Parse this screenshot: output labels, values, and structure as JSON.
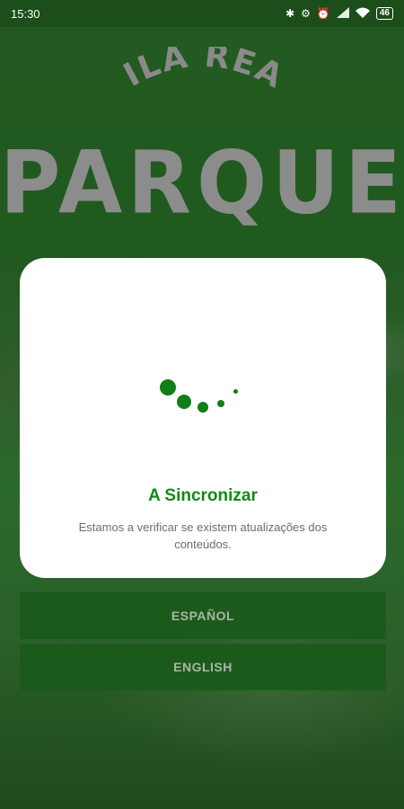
{
  "status_bar": {
    "time": "15:30",
    "battery": "46",
    "icons": [
      "bluetooth-icon",
      "data-saver-icon",
      "alarm-icon",
      "signal-icon",
      "wifi-icon",
      "battery-icon"
    ]
  },
  "logo": {
    "top_text": "VILA REAL",
    "main_text": "PARQUE"
  },
  "languages": {
    "spanish": "ESPAÑOL",
    "english": "ENGLISH"
  },
  "sync_dialog": {
    "title": "A Sincronizar",
    "message": "Estamos a verificar se existem atualizações dos conteúdos.",
    "accent_color": "#108a15"
  }
}
